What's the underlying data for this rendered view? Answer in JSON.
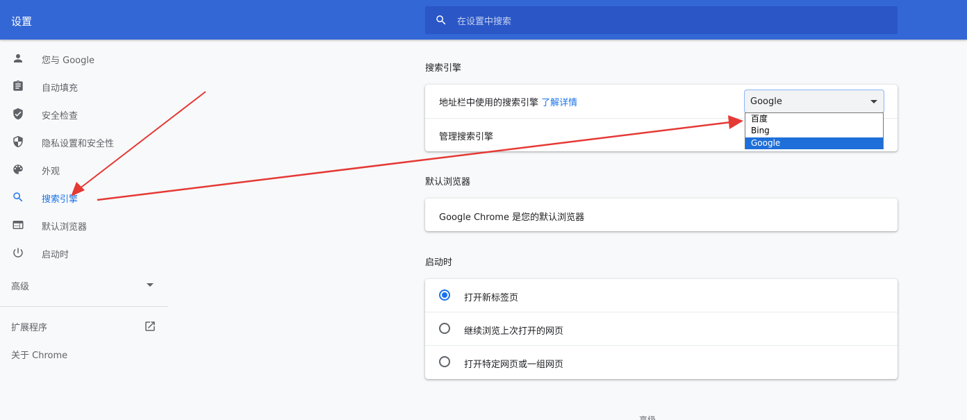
{
  "header": {
    "title": "设置",
    "search_placeholder": "在设置中搜索"
  },
  "sidebar": {
    "items": [
      {
        "label": "您与 Google",
        "icon": "person-icon"
      },
      {
        "label": "自动填充",
        "icon": "clipboard-icon"
      },
      {
        "label": "安全检查",
        "icon": "shield-check-icon"
      },
      {
        "label": "隐私设置和安全性",
        "icon": "shield-icon"
      },
      {
        "label": "外观",
        "icon": "palette-icon"
      },
      {
        "label": "搜索引擎",
        "icon": "search-icon",
        "active": true
      },
      {
        "label": "默认浏览器",
        "icon": "browser-window-icon"
      },
      {
        "label": "启动时",
        "icon": "power-icon"
      }
    ],
    "advanced_label": "高级",
    "extensions_label": "扩展程序",
    "about_label": "关于 Chrome"
  },
  "search_engine": {
    "title": "搜索引擎",
    "row1_label": "地址栏中使用的搜索引擎",
    "learn_more": "了解详情",
    "selected": "Google",
    "options": [
      "百度",
      "Bing",
      "Google"
    ],
    "manage_label": "管理搜索引擎"
  },
  "default_browser": {
    "title": "默认浏览器",
    "status": "Google Chrome 是您的默认浏览器"
  },
  "startup": {
    "title": "启动时",
    "options": [
      {
        "label": "打开新标签页",
        "checked": true
      },
      {
        "label": "继续浏览上次打开的网页",
        "checked": false
      },
      {
        "label": "打开特定网页或一组网页",
        "checked": false
      }
    ]
  },
  "footer_fragment": "高级",
  "colors": {
    "header": "#3367d6",
    "accent": "#1a73e8",
    "annotation_arrow": "#e53935"
  }
}
